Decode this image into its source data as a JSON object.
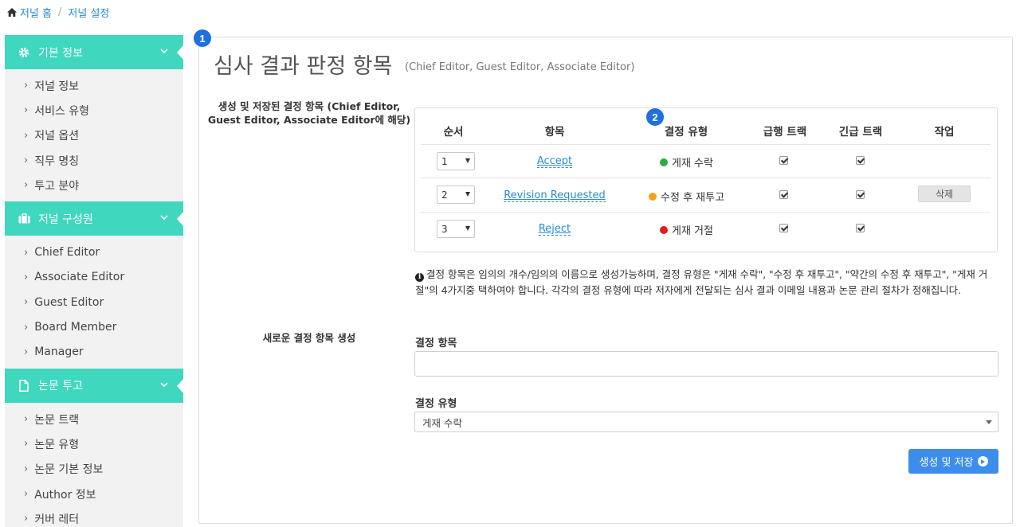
{
  "breadcrumb": {
    "home": "저널 홈",
    "separator": "/",
    "current": "저널 설정"
  },
  "sidebar": {
    "sections": [
      {
        "title": "기본 정보",
        "icon": "gear-icon",
        "items": [
          "저널 정보",
          "서비스 유형",
          "저널 옵션",
          "직무 명칭",
          "투고 분야"
        ]
      },
      {
        "title": "저널 구성원",
        "icon": "briefcase-icon",
        "items": [
          "Chief Editor",
          "Associate Editor",
          "Guest Editor",
          "Board Member",
          "Manager"
        ]
      },
      {
        "title": "논문 투고",
        "icon": "file-icon",
        "items": [
          "논문 트랙",
          "논문 유형",
          "논문 기본 정보",
          "Author 정보",
          "커버 레터"
        ]
      }
    ]
  },
  "badges": {
    "one": "1",
    "two": "2"
  },
  "main": {
    "title": "심사 결과 판정 항목",
    "subtitle": "(Chief Editor, Guest Editor, Associate Editor)",
    "existing_label": "생성 및 저장된 결정 항목 (Chief Editor, Guest Editor, Associate Editor에 해당)",
    "table": {
      "headers": {
        "order": "순서",
        "item": "항목",
        "type": "결정 유형",
        "fast": "급행 트랙",
        "urgent": "긴급 트랙",
        "action": "작업"
      },
      "rows": [
        {
          "order": "1",
          "item": "Accept",
          "type": "게재 수락",
          "color": "#2eaa4a",
          "fast": true,
          "urgent": true,
          "action": ""
        },
        {
          "order": "2",
          "item": "Revision Requested",
          "type": "수정 후 재투고",
          "color": "#f5a11a",
          "fast": true,
          "urgent": true,
          "action": "삭제"
        },
        {
          "order": "3",
          "item": "Reject",
          "type": "게재 거절",
          "color": "#e51b1b",
          "fast": true,
          "urgent": true,
          "action": ""
        }
      ]
    },
    "notice": "결정 항목은 임의의 개수/임의의 이름으로 생성가능하며, 결정 유형은 \"게재 수락\", \"수정 후 재투고\", \"약간의 수정 후 재투고\", \"게재 거절\"의 4가지중 택하여야 합니다. 각각의 결정 유형에 따라 저자에게 전달되는 심사 결과 이메일 내용과 논문 관리 절차가 정해집니다.",
    "new_label": "새로운 결정 항목 생성",
    "form": {
      "item_label": "결정 항목",
      "item_value": "",
      "item_placeholder": "",
      "type_label": "결정 유형",
      "type_value": "게재 수락",
      "submit": "생성 및 저장"
    }
  },
  "colors": {
    "accent": "#3fd8be",
    "link": "#2a8bd6",
    "button": "#3d8eea",
    "badge": "#1f6fe0"
  }
}
